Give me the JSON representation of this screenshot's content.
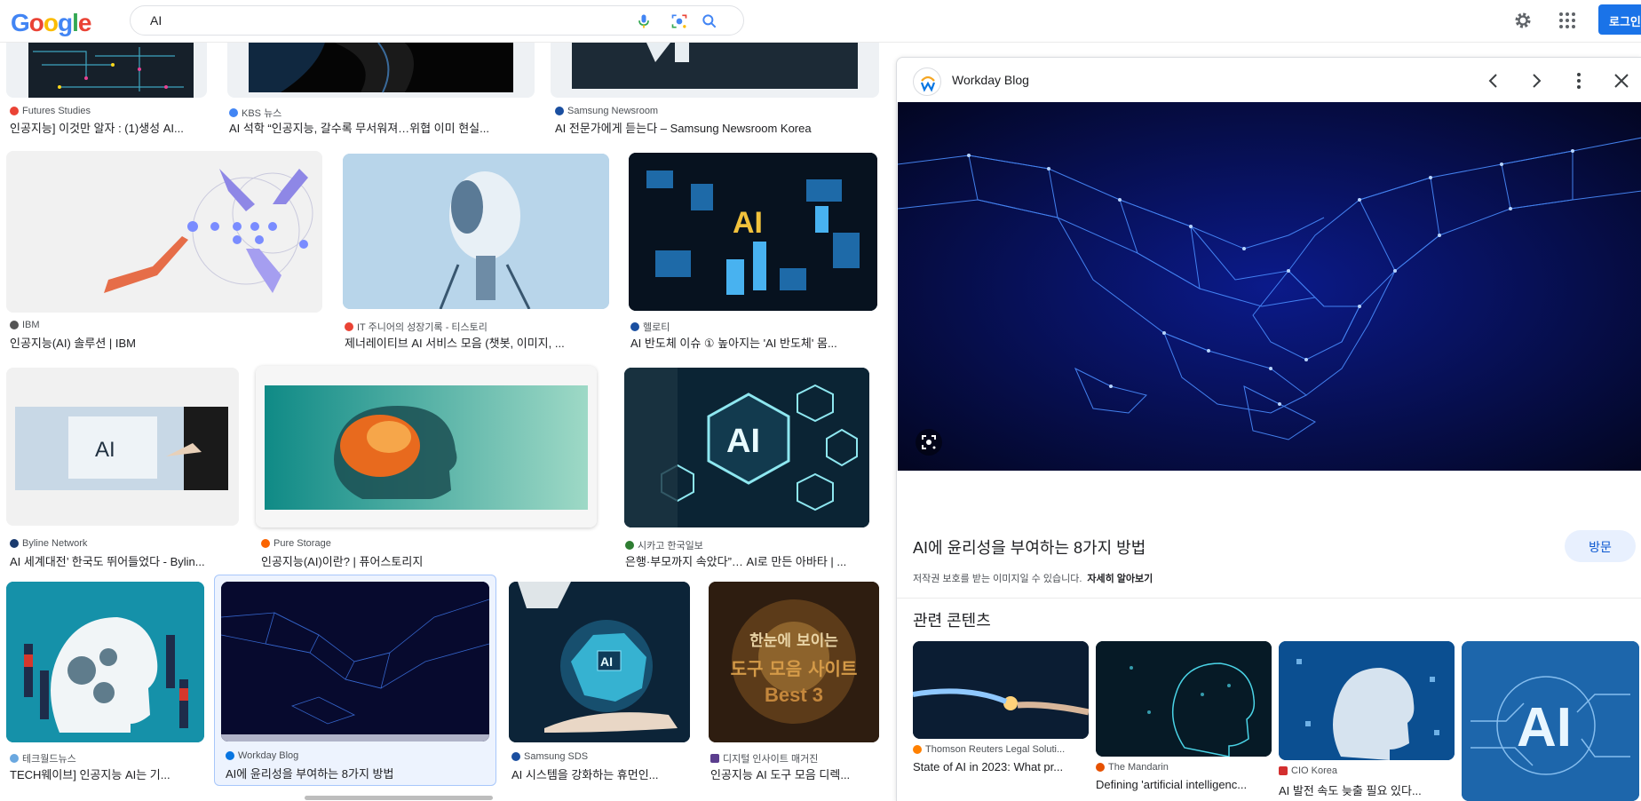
{
  "header": {
    "logo_letters": [
      "G",
      "o",
      "o",
      "g",
      "l",
      "e"
    ],
    "search_value": "AI",
    "login_label": "로그인"
  },
  "results": [
    {
      "source": "Futures Studies",
      "title": "인공지능] 이것만 알자 : (1)생성 AI...",
      "fav_color": "#ea4335"
    },
    {
      "source": "KBS 뉴스",
      "title": "AI 석학 “인공지능, 갈수록 무서워져…위협 이미 현실...",
      "fav_color": "#4285f4"
    },
    {
      "source": "Samsung Newsroom",
      "title": "AI 전문가에게 듣는다 – Samsung Newsroom Korea",
      "fav_color": "#1a4fa0"
    },
    {
      "source": "IBM",
      "title": "인공지능(AI) 솔루션 | IBM",
      "fav_color": "#555555"
    },
    {
      "source": "IT 주니어의 성장기록 - 티스토리",
      "title": "제너레이티브 AI 서비스 모음 (챗봇, 이미지, ...",
      "fav_color": "#ea4335"
    },
    {
      "source": "헬로티",
      "title": "AI 반도체 이슈 ① 높아지는 'AI 반도체' 몸...",
      "fav_color": "#1a4fa0"
    },
    {
      "source": "Byline Network",
      "title": "AI 세계대전’ 한국도 뛰어들었다 - Bylin...",
      "fav_color": "#1a3a6e"
    },
    {
      "source": "Pure Storage",
      "title": "인공지능(AI)이란? | 퓨어스토리지",
      "fav_color": "#fa6400"
    },
    {
      "source": "시카고 한국일보",
      "title": "은행·부모까지 속았다”… AI로 만든 아바타 | ...",
      "fav_color": "#2e7d32"
    },
    {
      "source": "테크월드뉴스",
      "title": "TECH웨이브] 인공지능 AI는 기...",
      "fav_color": "#6aa8e0"
    },
    {
      "source": "Workday Blog",
      "title": "AI에 윤리성을 부여하는 8가지 방법",
      "fav_color": "#0875e1"
    },
    {
      "source": "Samsung SDS",
      "title": "AI 시스템을 강화하는 휴먼인...",
      "fav_color": "#1a4fa0"
    },
    {
      "source": "디지털 인사이트 매거진",
      "title": "인공지능 AI 도구 모음 디렉...",
      "fav_color": "#5b3e8e"
    }
  ],
  "thumb_texts": {
    "ai_badge": "AI",
    "tools_line1": "한눈에 보이는",
    "tools_line2": "도구 모음 사이트",
    "tools_line3": "Best 3"
  },
  "panel": {
    "site": "Workday Blog",
    "title": "AI에 윤리성을 부여하는 8가지 방법",
    "visit_label": "방문",
    "notice": "저작권 보호를 받는 이미지일 수 있습니다.",
    "learn_more": "자세히 알아보기",
    "related_heading": "관련 콘텐츠",
    "related": [
      {
        "source": "Thomson Reuters Legal Soluti...",
        "title": "State of AI in 2023: What pr...",
        "fav_color": "#ff8000"
      },
      {
        "source": "The Mandarin",
        "title": "Defining 'artificial intelligenc...",
        "fav_color": "#e65100"
      },
      {
        "source": "CIO Korea",
        "title": "AI 발전 속도 늦출 필요 있다...",
        "fav_color": "#d32f2f"
      },
      {
        "source": "",
        "title": "",
        "fav_color": "#1565c0"
      }
    ]
  },
  "colors": {
    "accent": "#1a73e8",
    "selected_bg": "#edf3fe"
  }
}
